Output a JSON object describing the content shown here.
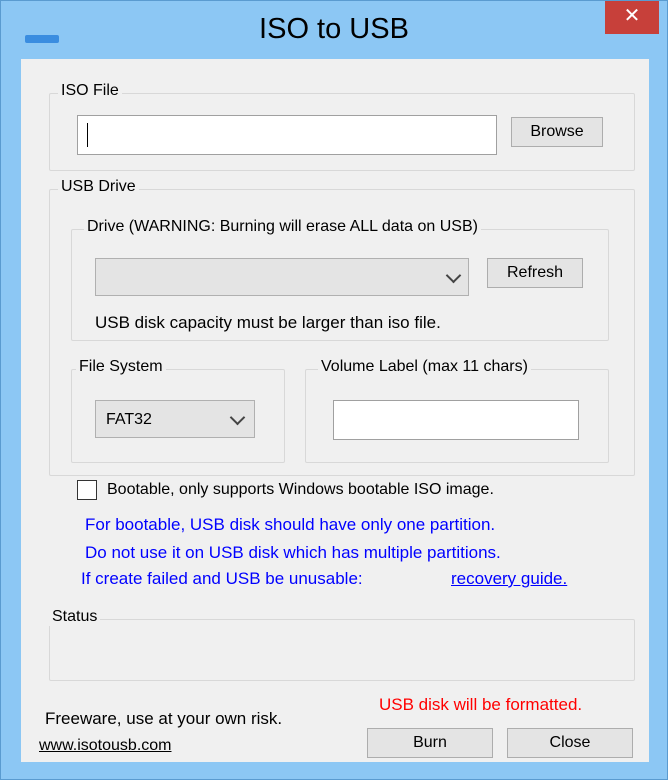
{
  "window": {
    "title": "ISO to USB",
    "close_glyph": "✕"
  },
  "iso_file": {
    "group_label": "ISO File",
    "path_value": "",
    "browse_label": "Browse"
  },
  "usb_drive": {
    "group_label": "USB Drive",
    "drive_group_label": "Drive (WARNING: Burning will erase ALL data on USB)",
    "drive_selected": "",
    "refresh_label": "Refresh",
    "capacity_note": "USB disk capacity must be larger than iso file.",
    "file_system_label": "File System",
    "file_system_selected": "FAT32",
    "volume_label_label": "Volume Label (max 11 chars)",
    "volume_label_value": ""
  },
  "bootable": {
    "checked": false,
    "label": "Bootable, only supports Windows bootable ISO image.",
    "note_line1": "For bootable, USB disk should have only one partition.",
    "note_line2": "Do not use it on USB disk which has multiple partitions.",
    "note_line3": "If create failed and USB be unusable:",
    "recovery_link": "recovery guide."
  },
  "status": {
    "group_label": "Status",
    "text": ""
  },
  "footer": {
    "freeware_text": "Freeware, use at your own risk.",
    "website_link": "www.isotousb.com",
    "format_warning": "USB disk will be formatted.",
    "burn_label": "Burn",
    "close_label": "Close"
  },
  "colors": {
    "frame": "#8cc7f4",
    "client": "#f0f0f0",
    "close_button": "#c7403a",
    "note_blue": "#0000ff",
    "warning_red": "#ff0000"
  },
  "icons": {
    "app_icon": "app-icon",
    "close_icon": "close-icon",
    "dropdown_icon": "chevron-down-icon"
  }
}
